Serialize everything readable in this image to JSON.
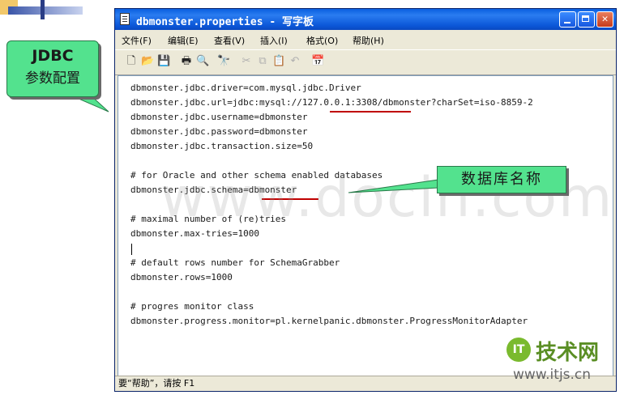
{
  "window": {
    "title": "dbmonster.properties - 写字板",
    "menu": [
      "文件(F)",
      "编辑(E)",
      "查看(V)",
      "插入(I)",
      "格式(O)",
      "帮助(H)"
    ],
    "status": "要“帮助”，请按 F1"
  },
  "toolbar": {
    "icons": [
      "new-icon",
      "open-icon",
      "save-icon",
      "print-icon",
      "print-preview-icon",
      "find-icon",
      "cut-icon",
      "copy-icon",
      "paste-icon",
      "undo-icon",
      "datetime-icon"
    ]
  },
  "editor": {
    "lines": [
      "dbmonster.jdbc.driver=com.mysql.jdbc.Driver",
      "dbmonster.jdbc.url=jdbc:mysql://127.0.0.1:3308/dbmonster?charSet=iso-8859-2",
      "dbmonster.jdbc.username=dbmonster",
      "dbmonster.jdbc.password=dbmonster",
      "dbmonster.jdbc.transaction.size=50",
      "",
      "# for Oracle and other schema enabled databases",
      "dbmonster.jdbc.schema=dbmonster",
      "",
      "# maximal number of (re)tries",
      "dbmonster.max-tries=1000",
      "",
      "# default rows number for SchemaGrabber",
      "dbmonster.rows=1000",
      "",
      "# progres monitor class",
      "dbmonster.progress.monitor=pl.kernelpanic.dbmonster.ProgressMonitorAdapter"
    ]
  },
  "callouts": {
    "jdbc_title": "JDBC",
    "jdbc_sub": "参数配置",
    "dbname": "数据库名称"
  },
  "watermark": "www.docin.com",
  "logo": {
    "badge": "IT",
    "name": "技术网",
    "url": "www.itjs.cn"
  },
  "colors": {
    "titlebar": "#0a5fe0",
    "callout": "#53e28e",
    "underline": "#c00000"
  }
}
